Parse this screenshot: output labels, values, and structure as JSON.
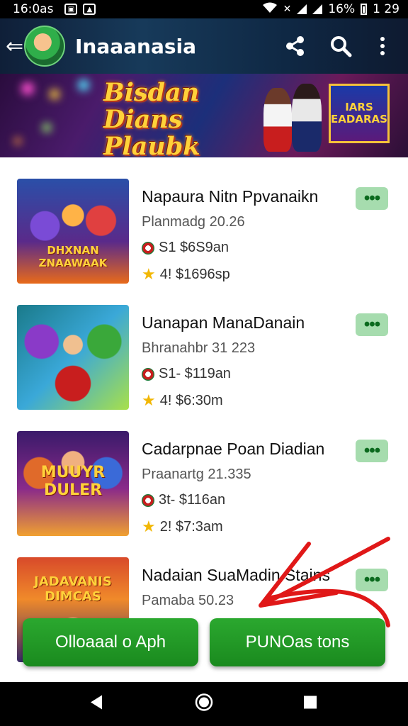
{
  "status_bar": {
    "time": "16:0as",
    "battery": "16%",
    "clock_right": "1 29"
  },
  "app_bar": {
    "title": "Inaaanasia"
  },
  "banner": {
    "title": "Bisdan Dians Plaubk",
    "badge": "IARS EADARAS"
  },
  "games": [
    {
      "name": "Napaura Nitn Ppvanaikn",
      "subtitle": "Planmadg 20.26",
      "price": "S1 $6S9an",
      "rating": "4! $1696sp",
      "thumb_title": "DHXNAN ZNAAWAAK"
    },
    {
      "name": "Uanapan ManaDanain",
      "subtitle": "Bhranahbr 31 223",
      "price": "S1- $119an",
      "rating": "4! $6:30m",
      "thumb_title": ""
    },
    {
      "name": "Cadarpnae Poan Diadian",
      "subtitle": "Praanartg 21.335",
      "price": "3t- $116an",
      "rating": "2! $7:3am",
      "thumb_title": "MUUYR DULER"
    },
    {
      "name": "Nadaian SuaMadin Stains",
      "subtitle": "Pamaba 50.23",
      "price": "",
      "rating": "",
      "thumb_title": "JADAVANIS DIMCAS"
    }
  ],
  "buttons": {
    "left": "Olloaaal o Aph",
    "right": "PUNOas tons"
  },
  "colors": {
    "accent_green": "#1a8a1e",
    "more_bg": "#a6dcae",
    "arrow_red": "#e01818"
  }
}
